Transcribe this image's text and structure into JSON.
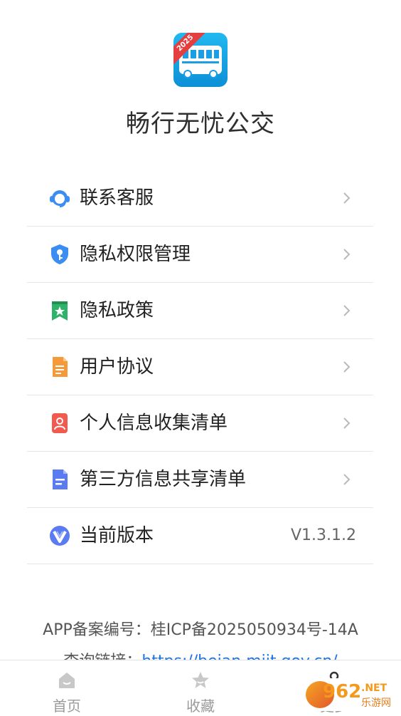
{
  "app": {
    "name": "畅行无忧公交",
    "icon_badge": "2025"
  },
  "menu": [
    {
      "label": "联系客服",
      "icon": "headset-icon",
      "color": "#2f80ed"
    },
    {
      "label": "隐私权限管理",
      "icon": "shield-key-icon",
      "color": "#2f80ed"
    },
    {
      "label": "隐私政策",
      "icon": "bookmark-star-icon",
      "color": "#27ae60"
    },
    {
      "label": "用户协议",
      "icon": "document-icon",
      "color": "#f2994a"
    },
    {
      "label": "个人信息收集清单",
      "icon": "person-card-icon",
      "color": "#eb5757"
    },
    {
      "label": "第三方信息共享清单",
      "icon": "list-doc-icon",
      "color": "#5b7bf0"
    },
    {
      "label": "当前版本",
      "icon": "version-v-icon",
      "color": "#5b7bf0",
      "value": "V1.3.1.2"
    }
  ],
  "footer": {
    "record_text": "APP备案编号：桂ICP备2025050934号-14A",
    "query_prefix": "查询链接：",
    "query_link": "https://beian.miit.gov.cn/"
  },
  "tabs": [
    {
      "label": "首页",
      "icon": "home-icon"
    },
    {
      "label": "收藏",
      "icon": "star-icon"
    },
    {
      "label": "更多",
      "icon": "more-icon"
    }
  ],
  "watermark": {
    "number": "962",
    "suffix": ".NET",
    "sub": "乐游网"
  }
}
